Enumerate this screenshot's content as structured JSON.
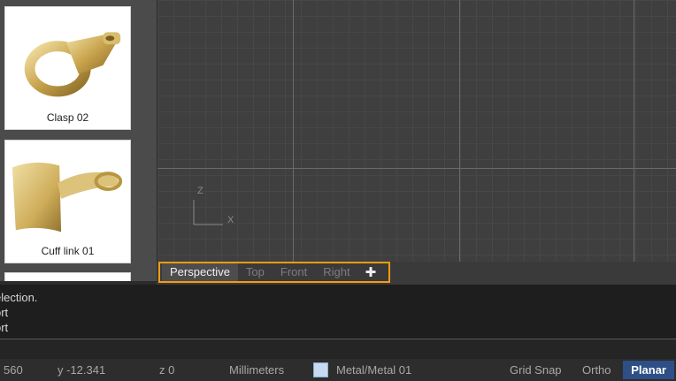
{
  "library": {
    "items": [
      {
        "label": "Clasp 02",
        "icon": "clasp-thumbnail"
      },
      {
        "label": "Cuff link 01",
        "icon": "cufflink-thumbnail"
      }
    ]
  },
  "viewport": {
    "axis_z": "Z",
    "axis_x": "X"
  },
  "viewtabs": {
    "tabs": [
      "Perspective",
      "Top",
      "Front",
      "Right"
    ],
    "active": "Perspective",
    "add_icon": "plus-icon"
  },
  "history": {
    "lines": [
      "election.",
      "ort",
      "ort"
    ]
  },
  "status": {
    "x": "560",
    "y": "y -12.341",
    "z": "z 0",
    "units": "Millimeters",
    "material": "Metal/Metal 01",
    "material_color": "#c6dbf0",
    "grid_snap": "Grid Snap",
    "ortho": "Ortho",
    "planar": "Planar"
  },
  "colors": {
    "accent_outline": "#f39c12",
    "planar_bg": "#2e4f86"
  }
}
